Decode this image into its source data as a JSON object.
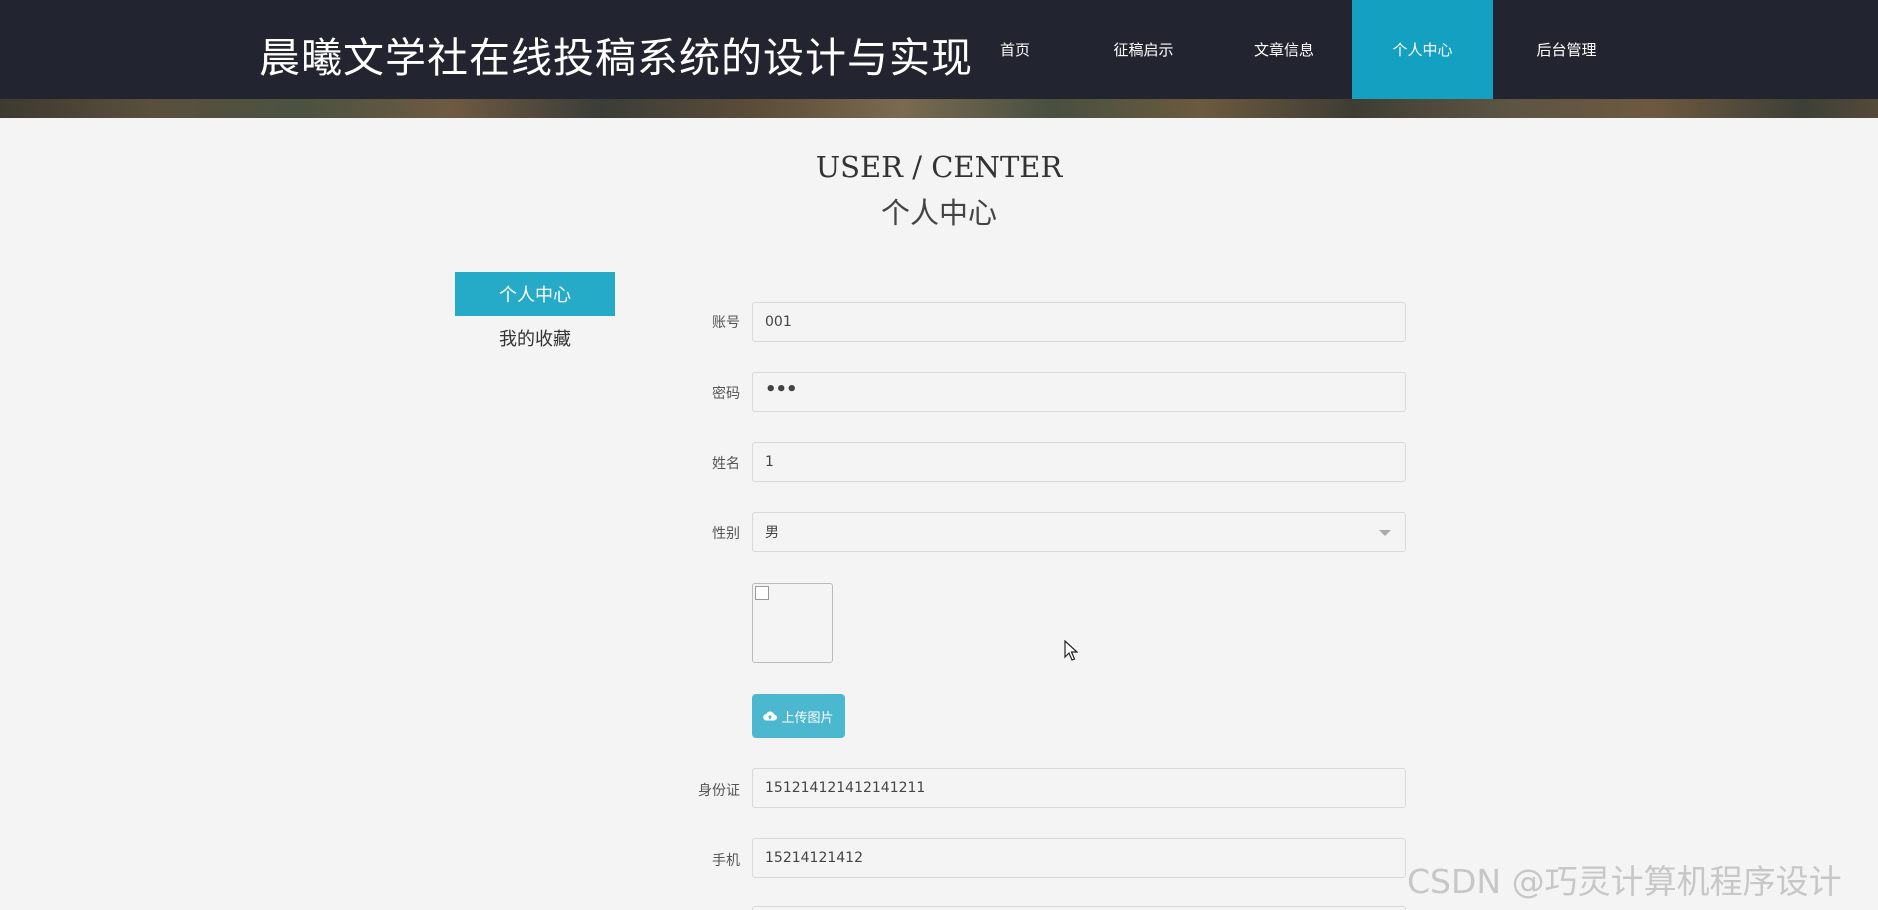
{
  "header": {
    "title": "晨曦文学社在线投稿系统的设计与实现",
    "nav": [
      {
        "label": "首页"
      },
      {
        "label": "征稿启示"
      },
      {
        "label": "文章信息"
      },
      {
        "label": "个人中心"
      },
      {
        "label": "后台管理"
      }
    ],
    "active_index": 3,
    "active_color": "#14a0c0"
  },
  "page_heading": {
    "en": "USER / CENTER",
    "cn": "个人中心"
  },
  "sidebar": {
    "items": [
      {
        "label": "个人中心"
      },
      {
        "label": "我的收藏"
      }
    ]
  },
  "form": {
    "account": {
      "label": "账号",
      "value": "001"
    },
    "password": {
      "label": "密码",
      "value": "•••"
    },
    "name": {
      "label": "姓名",
      "value": "1"
    },
    "gender": {
      "label": "性别",
      "value": "男"
    },
    "upload_button": "上传图片",
    "id_card": {
      "label": "身份证",
      "value": "151214121412141211"
    },
    "phone": {
      "label": "手机",
      "value": "15214121412"
    }
  },
  "watermark": "CSDN @巧灵计算机程序设计"
}
